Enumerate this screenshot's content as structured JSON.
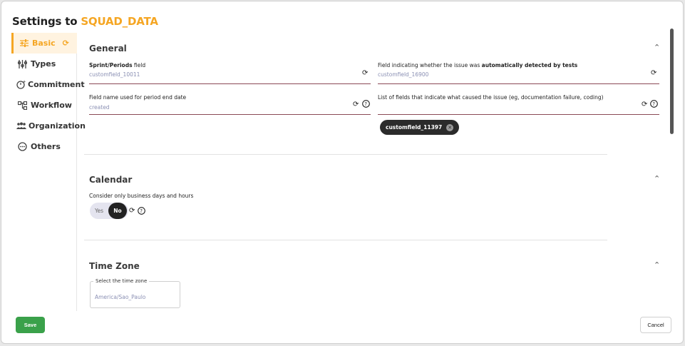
{
  "header": {
    "title_prefix": "Settings to ",
    "title_accent": "SQUAD_DATA"
  },
  "sidebar": {
    "items": [
      {
        "label": "Basic",
        "icon": "sliders-icon",
        "active": true
      },
      {
        "label": "Types",
        "icon": "types-icon"
      },
      {
        "label": "Commitment",
        "icon": "commitment-icon"
      },
      {
        "label": "Workflow",
        "icon": "workflow-icon"
      },
      {
        "label": "Organization",
        "icon": "organization-icon"
      },
      {
        "label": "Others",
        "icon": "more-icon"
      }
    ],
    "reset_icon": "reset-icon"
  },
  "general": {
    "title": "General",
    "sprint_label_bold": "Sprint/Periods",
    "sprint_label_rest": " field",
    "sprint_value": "customfield_10011",
    "autodetect_label_pre": "Field indicating whether the issue was ",
    "autodetect_label_bold": "automatically detected by tests",
    "autodetect_value": "customfield_16900",
    "period_end_label": "Field name used for period end date",
    "period_end_value": "created",
    "cause_label": "List of fields that indicate what caused the issue (eg, documentation failure, coding)",
    "cause_chip": "customfield_11397"
  },
  "calendar": {
    "title": "Calendar",
    "business_label": "Consider only business days and hours",
    "yes": "Yes",
    "no": "No",
    "selected": "No"
  },
  "timezone": {
    "title": "Time Zone",
    "select_label": "Select the time zone",
    "value": "America/Sao_Paulo"
  },
  "footer": {
    "save": "Save",
    "cancel": "Cancel"
  },
  "colors": {
    "accent": "#f5a623",
    "save": "#3aa14a",
    "underline": "#8b4a55"
  }
}
